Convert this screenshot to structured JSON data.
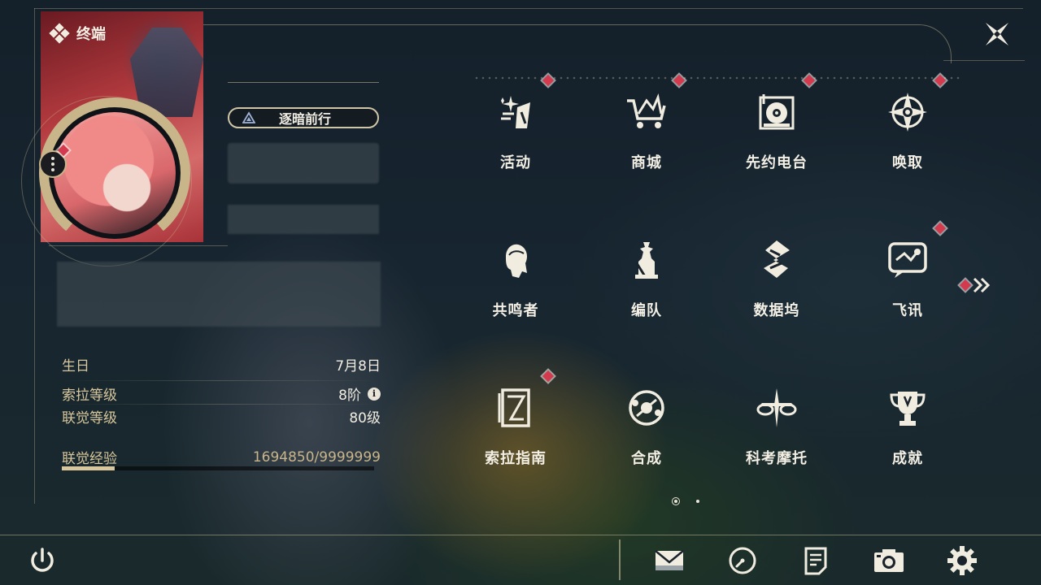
{
  "header": {
    "title": "终端",
    "title_icon": "diamond-cluster-icon",
    "close_icon": "close-icon"
  },
  "profile": {
    "player_title": "逐暗前行",
    "avatar_menu_icon": "more-vertical-icon",
    "stats": [
      {
        "label": "生日",
        "value": "7月8日"
      },
      {
        "label": "索拉等级",
        "value": "8阶"
      },
      {
        "label": "联觉等级",
        "value": "80级"
      },
      {
        "label": "联觉经验",
        "value": "1694850/9999999"
      }
    ],
    "exp_progress": 0.1695,
    "info_icon_text": "i"
  },
  "menu": [
    {
      "label": "活动",
      "icon": "sparkle-icon",
      "badge": true
    },
    {
      "label": "商城",
      "icon": "shopping-cart-icon",
      "badge": true
    },
    {
      "label": "先约电台",
      "icon": "record-player-icon",
      "badge": true
    },
    {
      "label": "唤取",
      "icon": "compass-star-icon",
      "badge": true
    },
    {
      "label": "共鸣者",
      "icon": "character-head-icon",
      "badge": false
    },
    {
      "label": "编队",
      "icon": "chess-pieces-icon",
      "badge": false
    },
    {
      "label": "数据坞",
      "icon": "data-dock-icon",
      "badge": false
    },
    {
      "label": "飞讯",
      "icon": "message-bubble-icon",
      "badge": true
    },
    {
      "label": "索拉指南",
      "icon": "guide-book-icon",
      "badge": true
    },
    {
      "label": "合成",
      "icon": "synthesis-orb-icon",
      "badge": false
    },
    {
      "label": "科考摩托",
      "icon": "motorbike-icon",
      "badge": false
    },
    {
      "label": "成就",
      "icon": "trophy-icon",
      "badge": false
    }
  ],
  "pagination": {
    "current": 1,
    "total": 2
  },
  "bottom_bar": [
    "power-icon",
    "mail-icon",
    "clock-icon",
    "notes-icon",
    "camera-icon",
    "settings-gear-icon"
  ],
  "colors": {
    "accent_gold": "#d8c79c",
    "badge_red": "#d33a4e",
    "text": "#f3efe4"
  }
}
